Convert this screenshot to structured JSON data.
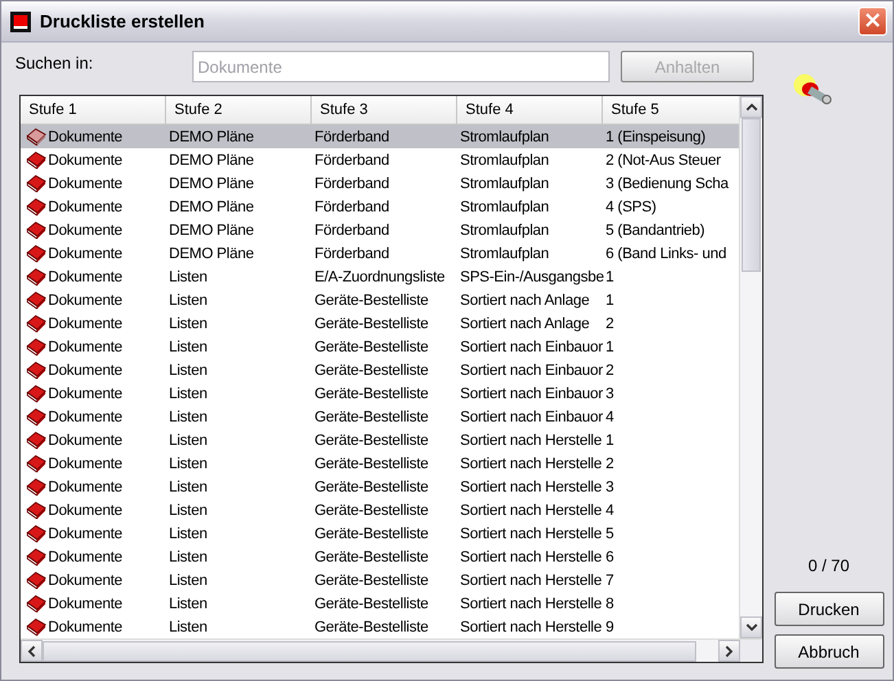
{
  "window": {
    "title": "Druckliste erstellen",
    "close": "×"
  },
  "search": {
    "label": "Suchen in:",
    "value": "Dokumente",
    "disabled": true
  },
  "stop_button": {
    "label": "Anhalten",
    "disabled": true
  },
  "table": {
    "columns": [
      "Stufe 1",
      "Stufe 2",
      "Stufe 3",
      "Stufe 4",
      "Stufe 5"
    ],
    "rows": [
      {
        "selected": true,
        "cells": [
          "Dokumente",
          "DEMO Pläne",
          "Förderband",
          "Stromlaufplan",
          "1 (Einspeisung)"
        ]
      },
      {
        "selected": false,
        "cells": [
          "Dokumente",
          "DEMO Pläne",
          "Förderband",
          "Stromlaufplan",
          "2 (Not-Aus Steuer"
        ]
      },
      {
        "selected": false,
        "cells": [
          "Dokumente",
          "DEMO Pläne",
          "Förderband",
          "Stromlaufplan",
          "3 (Bedienung Scha"
        ]
      },
      {
        "selected": false,
        "cells": [
          "Dokumente",
          "DEMO Pläne",
          "Förderband",
          "Stromlaufplan",
          "4 (SPS)"
        ]
      },
      {
        "selected": false,
        "cells": [
          "Dokumente",
          "DEMO Pläne",
          "Förderband",
          "Stromlaufplan",
          "5 (Bandantrieb)"
        ]
      },
      {
        "selected": false,
        "cells": [
          "Dokumente",
          "DEMO Pläne",
          "Förderband",
          "Stromlaufplan",
          "6 (Band Links- und"
        ]
      },
      {
        "selected": false,
        "cells": [
          "Dokumente",
          "Listen",
          "E/A-Zuordnungsliste",
          "SPS-Ein-/Ausgangsbe",
          "1"
        ]
      },
      {
        "selected": false,
        "cells": [
          "Dokumente",
          "Listen",
          "Geräte-Bestelliste",
          "Sortiert nach Anlage",
          "1"
        ]
      },
      {
        "selected": false,
        "cells": [
          "Dokumente",
          "Listen",
          "Geräte-Bestelliste",
          "Sortiert nach Anlage",
          "2"
        ]
      },
      {
        "selected": false,
        "cells": [
          "Dokumente",
          "Listen",
          "Geräte-Bestelliste",
          "Sortiert nach Einbauor",
          "1"
        ]
      },
      {
        "selected": false,
        "cells": [
          "Dokumente",
          "Listen",
          "Geräte-Bestelliste",
          "Sortiert nach Einbauor",
          "2"
        ]
      },
      {
        "selected": false,
        "cells": [
          "Dokumente",
          "Listen",
          "Geräte-Bestelliste",
          "Sortiert nach Einbauor",
          "3"
        ]
      },
      {
        "selected": false,
        "cells": [
          "Dokumente",
          "Listen",
          "Geräte-Bestelliste",
          "Sortiert nach Einbauor",
          "4"
        ]
      },
      {
        "selected": false,
        "cells": [
          "Dokumente",
          "Listen",
          "Geräte-Bestelliste",
          "Sortiert nach Herstelle",
          "1"
        ]
      },
      {
        "selected": false,
        "cells": [
          "Dokumente",
          "Listen",
          "Geräte-Bestelliste",
          "Sortiert nach Herstelle",
          "2"
        ]
      },
      {
        "selected": false,
        "cells": [
          "Dokumente",
          "Listen",
          "Geräte-Bestelliste",
          "Sortiert nach Herstelle",
          "3"
        ]
      },
      {
        "selected": false,
        "cells": [
          "Dokumente",
          "Listen",
          "Geräte-Bestelliste",
          "Sortiert nach Herstelle",
          "4"
        ]
      },
      {
        "selected": false,
        "cells": [
          "Dokumente",
          "Listen",
          "Geräte-Bestelliste",
          "Sortiert nach Herstelle",
          "5"
        ]
      },
      {
        "selected": false,
        "cells": [
          "Dokumente",
          "Listen",
          "Geräte-Bestelliste",
          "Sortiert nach Herstelle",
          "6"
        ]
      },
      {
        "selected": false,
        "cells": [
          "Dokumente",
          "Listen",
          "Geräte-Bestelliste",
          "Sortiert nach Herstelle",
          "7"
        ]
      },
      {
        "selected": false,
        "cells": [
          "Dokumente",
          "Listen",
          "Geräte-Bestelliste",
          "Sortiert nach Herstelle",
          "8"
        ]
      },
      {
        "selected": false,
        "cells": [
          "Dokumente",
          "Listen",
          "Geräte-Bestelliste",
          "Sortiert nach Herstelle",
          "9"
        ]
      }
    ]
  },
  "counter": "0 / 70",
  "buttons": [
    "Drucken",
    "Abbruch"
  ]
}
